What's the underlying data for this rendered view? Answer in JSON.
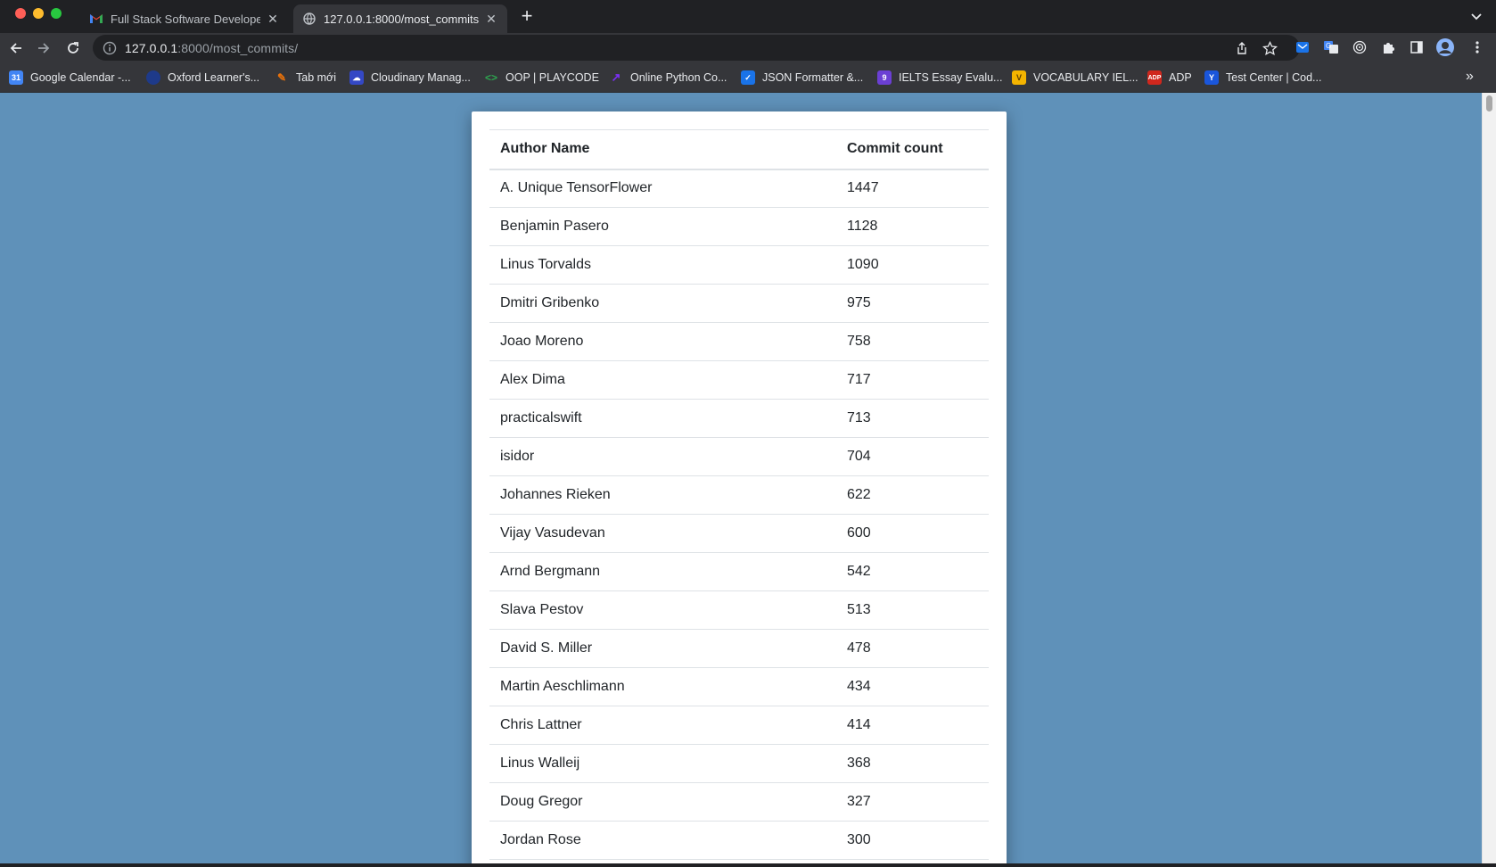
{
  "browser": {
    "tabs": [
      {
        "title": "Full Stack Software Developer",
        "icon": "gmail-icon",
        "active": false
      },
      {
        "title": "127.0.0.1:8000/most_commits/",
        "icon": "globe-icon",
        "active": true
      }
    ],
    "url": {
      "host": "127.0.0.1",
      "rest": ":8000/most_commits/"
    },
    "bookmarks": [
      {
        "label": "Google Calendar -...",
        "icon": "calendar-icon",
        "color": "#4285f4"
      },
      {
        "label": "Oxford Learner's...",
        "icon": "oxford-icon",
        "color": "#1e3a8a"
      },
      {
        "label": "Tab mới",
        "icon": "tab-icon",
        "color": "#e8710a"
      },
      {
        "label": "Cloudinary Manag...",
        "icon": "cloudinary-icon",
        "color": "#3448c5"
      },
      {
        "label": "OOP | PLAYCODE",
        "icon": "playcode-icon",
        "color": "#2ea44f"
      },
      {
        "label": "Online Python Co...",
        "icon": "python-icon",
        "color": "#7b2ff7"
      },
      {
        "label": "JSON Formatter &...",
        "icon": "check-icon",
        "color": "#1a73e8"
      },
      {
        "label": "IELTS Essay Evalu...",
        "icon": "ielts-icon",
        "color": "#6b3fd4"
      },
      {
        "label": "VOCABULARY IEL...",
        "icon": "vocab-icon",
        "color": "#f4b400"
      },
      {
        "label": "ADP",
        "icon": "adp-icon",
        "color": "#d0271d"
      },
      {
        "label": "Test Center | Cod...",
        "icon": "testcenter-icon",
        "color": "#1a56db"
      }
    ]
  },
  "table": {
    "headers": {
      "name": "Author Name",
      "count": "Commit count"
    },
    "rows": [
      {
        "name": "A. Unique TensorFlower",
        "count": "1447"
      },
      {
        "name": "Benjamin Pasero",
        "count": "1128"
      },
      {
        "name": "Linus Torvalds",
        "count": "1090"
      },
      {
        "name": "Dmitri Gribenko",
        "count": "975"
      },
      {
        "name": "Joao Moreno",
        "count": "758"
      },
      {
        "name": "Alex Dima",
        "count": "717"
      },
      {
        "name": "practicalswift",
        "count": "713"
      },
      {
        "name": "isidor",
        "count": "704"
      },
      {
        "name": "Johannes Rieken",
        "count": "622"
      },
      {
        "name": "Vijay Vasudevan",
        "count": "600"
      },
      {
        "name": "Arnd Bergmann",
        "count": "542"
      },
      {
        "name": "Slava Pestov",
        "count": "513"
      },
      {
        "name": "David S. Miller",
        "count": "478"
      },
      {
        "name": "Martin Aeschlimann",
        "count": "434"
      },
      {
        "name": "Chris Lattner",
        "count": "414"
      },
      {
        "name": "Linus Walleij",
        "count": "368"
      },
      {
        "name": "Doug Gregor",
        "count": "327"
      },
      {
        "name": "Jordan Rose",
        "count": "300"
      }
    ]
  },
  "colors": {
    "page_background": "#5f91b9",
    "card": "#ffffff",
    "text": "#212529"
  }
}
